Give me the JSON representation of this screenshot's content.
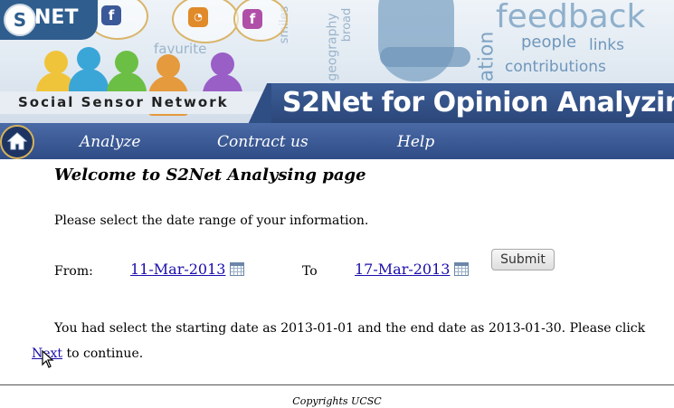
{
  "header": {
    "logo_text": "NET",
    "logo_letter": "S",
    "tagline": "Social Sensor Network",
    "site_title": "S2Net for Opinion Analyzing",
    "cloud_words": [
      "feedback",
      "people",
      "links",
      "contributions",
      "favurite",
      "smiles",
      "ation",
      "geography",
      "broad"
    ]
  },
  "nav": {
    "home_icon": "home-icon",
    "items": [
      {
        "label": "Analyze"
      },
      {
        "label": "Contract us"
      },
      {
        "label": "Help"
      }
    ]
  },
  "main": {
    "title": "Welcome to S2Net Analysing page",
    "prompt": "Please select the date range of your information.",
    "from_label": "From:",
    "from_date": "11-Mar-2013",
    "to_label": "To",
    "to_date": "17-Mar-2013",
    "submit_label": "Submit",
    "message_before": "You had select the starting date as 2013-01-01 and the end date as 2013-01-30. Please click ",
    "next_link": "Next",
    "message_after": " to continue."
  },
  "footer": {
    "copyright": "Copyrights UCSC"
  },
  "colors": {
    "nav_bg": "#3a5a96",
    "link": "#1a0dab",
    "title_band": "#2b4679"
  }
}
